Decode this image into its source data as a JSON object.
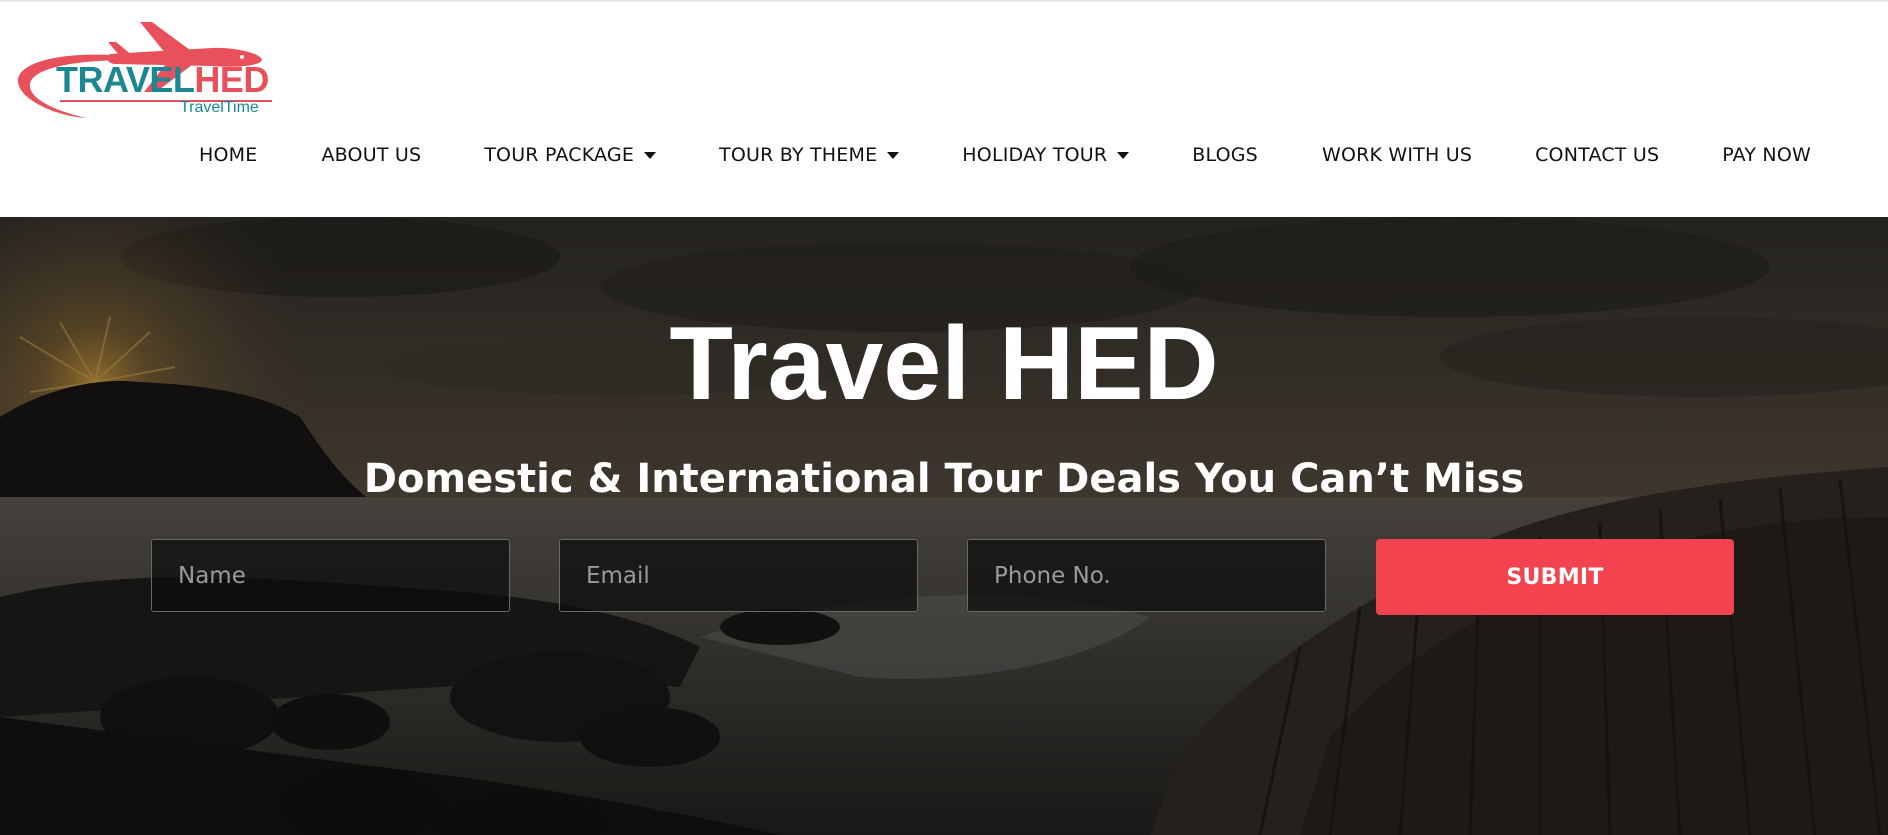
{
  "brand": {
    "logo_text_primary": "TRAVEL",
    "logo_text_accent": "HED",
    "tagline": "TravelTime",
    "colors": {
      "teal": "#1a8793",
      "coral": "#e8505b"
    }
  },
  "nav": {
    "items": [
      {
        "label": "HOME",
        "has_dropdown": false
      },
      {
        "label": "ABOUT US",
        "has_dropdown": false
      },
      {
        "label": "TOUR PACKAGE",
        "has_dropdown": true
      },
      {
        "label": "TOUR BY THEME",
        "has_dropdown": true
      },
      {
        "label": "HOLIDAY TOUR",
        "has_dropdown": true
      },
      {
        "label": "BLOGS",
        "has_dropdown": false
      },
      {
        "label": "WORK WITH US",
        "has_dropdown": false
      },
      {
        "label": "CONTACT US",
        "has_dropdown": false
      },
      {
        "label": "PAY NOW",
        "has_dropdown": false
      }
    ]
  },
  "hero": {
    "title": "Travel HED",
    "subtitle": "Domestic & International Tour Deals You Can’t Miss",
    "form": {
      "name_placeholder": "Name",
      "email_placeholder": "Email",
      "phone_placeholder": "Phone No.",
      "submit_label": "SUBMIT"
    },
    "colors": {
      "submit": "#f2434e"
    }
  }
}
